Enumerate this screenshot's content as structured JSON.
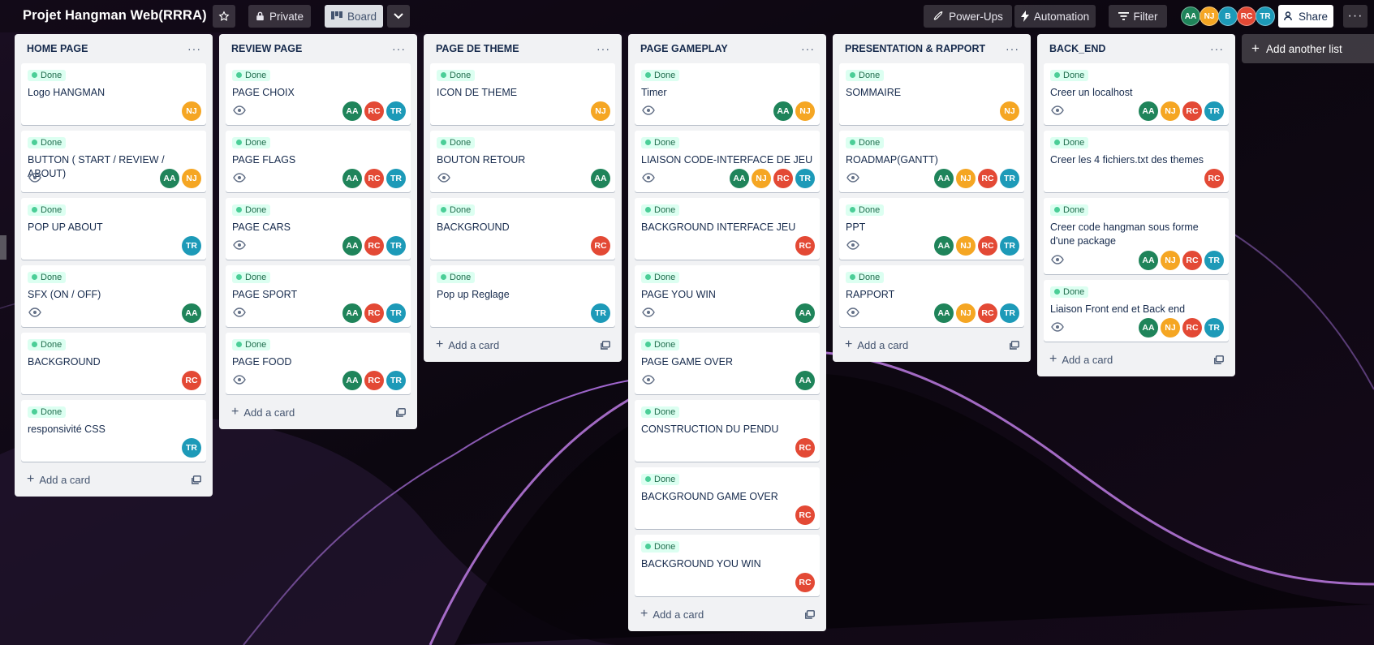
{
  "header": {
    "board_title": "Projet Hangman Web(RRRA)",
    "private_label": "Private",
    "board_label": "Board",
    "powerups_label": "Power-Ups",
    "automation_label": "Automation",
    "filter_label": "Filter",
    "share_label": "Share",
    "members": [
      "AA",
      "NJ",
      "B",
      "RC",
      "TR"
    ]
  },
  "add_list_label": "Add another list",
  "add_card_label": "Add a card",
  "label_done": "Done",
  "lists": [
    {
      "title": "HOME PAGE",
      "cards": [
        {
          "title": "Logo HANGMAN",
          "watch": false,
          "members": [
            "NJ"
          ]
        },
        {
          "title": "BUTTON ( START / REVIEW / ABOUT)",
          "watch": true,
          "members": [
            "AA",
            "NJ"
          ]
        },
        {
          "title": "POP UP ABOUT",
          "watch": false,
          "members": [
            "TR"
          ]
        },
        {
          "title": "SFX (ON / OFF)",
          "watch": true,
          "members": [
            "AA"
          ]
        },
        {
          "title": "BACKGROUND",
          "watch": false,
          "members": [
            "RC"
          ]
        },
        {
          "title": "responsivité CSS",
          "watch": false,
          "members": [
            "TR"
          ]
        }
      ]
    },
    {
      "title": "REVIEW PAGE",
      "cards": [
        {
          "title": "PAGE CHOIX",
          "watch": true,
          "members": [
            "AA",
            "RC",
            "TR"
          ]
        },
        {
          "title": "PAGE FLAGS",
          "watch": true,
          "members": [
            "AA",
            "RC",
            "TR"
          ]
        },
        {
          "title": "PAGE CARS",
          "watch": true,
          "members": [
            "AA",
            "RC",
            "TR"
          ]
        },
        {
          "title": "PAGE SPORT",
          "watch": true,
          "members": [
            "AA",
            "RC",
            "TR"
          ]
        },
        {
          "title": "PAGE FOOD",
          "watch": true,
          "members": [
            "AA",
            "RC",
            "TR"
          ]
        }
      ]
    },
    {
      "title": "PAGE DE THEME",
      "cards": [
        {
          "title": "ICON DE THEME",
          "watch": false,
          "members": [
            "NJ"
          ]
        },
        {
          "title": "BOUTON RETOUR",
          "watch": true,
          "members": [
            "AA"
          ]
        },
        {
          "title": "BACKGROUND",
          "watch": false,
          "members": [
            "RC"
          ]
        },
        {
          "title": "Pop up Reglage",
          "watch": false,
          "members": [
            "TR"
          ]
        }
      ]
    },
    {
      "title": "PAGE GAMEPLAY",
      "cards": [
        {
          "title": "Timer",
          "watch": true,
          "members": [
            "AA",
            "NJ"
          ]
        },
        {
          "title": "LIAISON CODE-INTERFACE DE JEU",
          "watch": true,
          "members": [
            "AA",
            "NJ",
            "RC",
            "TR"
          ]
        },
        {
          "title": "BACKGROUND INTERFACE JEU",
          "watch": false,
          "members": [
            "RC"
          ]
        },
        {
          "title": "PAGE YOU WIN",
          "watch": true,
          "members": [
            "AA"
          ]
        },
        {
          "title": "PAGE GAME OVER",
          "watch": true,
          "members": [
            "AA"
          ]
        },
        {
          "title": "CONSTRUCTION DU PENDU",
          "watch": false,
          "members": [
            "RC"
          ]
        },
        {
          "title": "BACKGROUND GAME OVER",
          "watch": false,
          "members": [
            "RC"
          ]
        },
        {
          "title": "BACKGROUND YOU WIN",
          "watch": false,
          "members": [
            "RC"
          ]
        }
      ]
    },
    {
      "title": "PRESENTATION & RAPPORT",
      "cards": [
        {
          "title": "SOMMAIRE",
          "watch": false,
          "members": [
            "NJ"
          ]
        },
        {
          "title": "ROADMAP(GANTT)",
          "watch": true,
          "members": [
            "AA",
            "NJ",
            "RC",
            "TR"
          ]
        },
        {
          "title": "PPT",
          "watch": true,
          "members": [
            "AA",
            "NJ",
            "RC",
            "TR"
          ]
        },
        {
          "title": "RAPPORT",
          "watch": true,
          "members": [
            "AA",
            "NJ",
            "RC",
            "TR"
          ]
        }
      ]
    },
    {
      "title": "BACK_END",
      "cards": [
        {
          "title": "Creer un localhost",
          "watch": true,
          "members": [
            "AA",
            "NJ",
            "RC",
            "TR"
          ]
        },
        {
          "title": "Creer les 4 fichiers.txt des themes",
          "watch": false,
          "members": [
            "RC"
          ]
        },
        {
          "title": "Creer code hangman sous forme d'une package",
          "watch": true,
          "members": [
            "AA",
            "NJ",
            "RC",
            "TR"
          ],
          "tall": true
        },
        {
          "title": "Liaison Front end et Back end",
          "watch": true,
          "members": [
            "AA",
            "NJ",
            "RC",
            "TR"
          ]
        }
      ]
    }
  ],
  "colors": {
    "done_label_bg": "#dcfff1",
    "done_label_dot": "#4bce97",
    "AA": "#1f845a",
    "NJ": "#f5a623",
    "RC": "#e34935",
    "TR": "#1d9ab8"
  },
  "icons": {
    "star": "star-icon",
    "lock": "lock-icon",
    "board": "board-icon",
    "chevron": "chevron-down-icon",
    "rocket": "rocket-icon",
    "bolt": "bolt-icon",
    "filter": "filter-icon",
    "share": "add-person-icon",
    "more": "more-icon",
    "watch": "eye-icon",
    "template": "template-icon"
  }
}
